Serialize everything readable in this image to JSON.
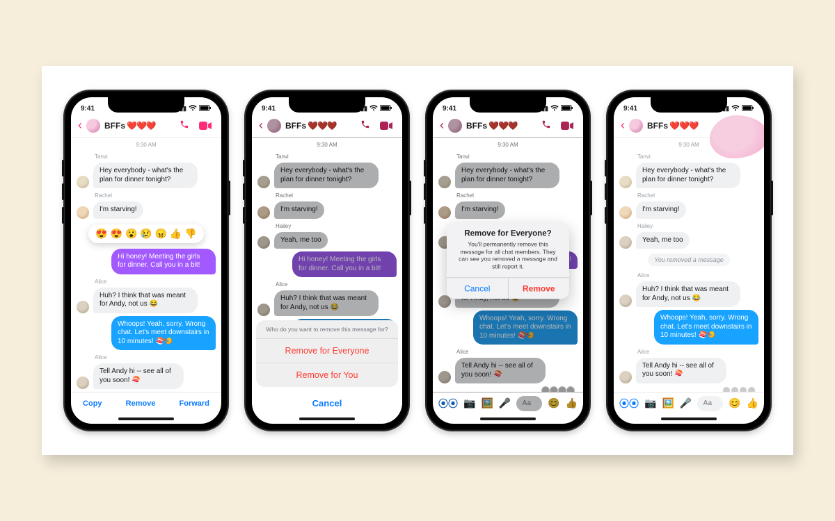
{
  "status": {
    "time": "9:41"
  },
  "header": {
    "title": "BFFs",
    "hearts": "❤️❤️❤️"
  },
  "chat": {
    "timestamp": "9:30 AM",
    "senders": {
      "tanvi": "Tanvi",
      "rachel": "Rachel",
      "hailey": "Hailey",
      "alice": "Alice"
    },
    "m1": "Hey everybody - what's the plan for dinner tonight?",
    "m2": "I'm starving!",
    "m3": "Yeah, me too",
    "m4": "Hi honey! Meeting the girls for dinner. Call you in a bit!",
    "m4_short": "for dinner. Call you in a bit!",
    "m5": "Huh? I think that was meant for Andy, not us 😂",
    "m6": "Whoops! Yeah, sorry. Wrong chat. Let's meet downstairs in 10 minutes! 🍣🍤",
    "m7": "Tell Andy hi -- see all of you soon! 🍣",
    "removed": "You removed a message"
  },
  "reactions": {
    "list": "😍 😍 😮 😢 😠 👍 👎"
  },
  "toolbar1": {
    "copy": "Copy",
    "remove": "Remove",
    "forward": "Forward"
  },
  "sheet": {
    "caption": "Who do you want to remove this message for?",
    "opt1": "Remove for Everyone",
    "opt2": "Remove for You",
    "cancel": "Cancel"
  },
  "alert": {
    "title": "Remove for Everyone?",
    "msg": "You'll permanently remove this message for all chat members. They can see you removed a message and still report it.",
    "cancel": "Cancel",
    "remove": "Remove"
  },
  "composer": {
    "placeholder": "Aa"
  }
}
